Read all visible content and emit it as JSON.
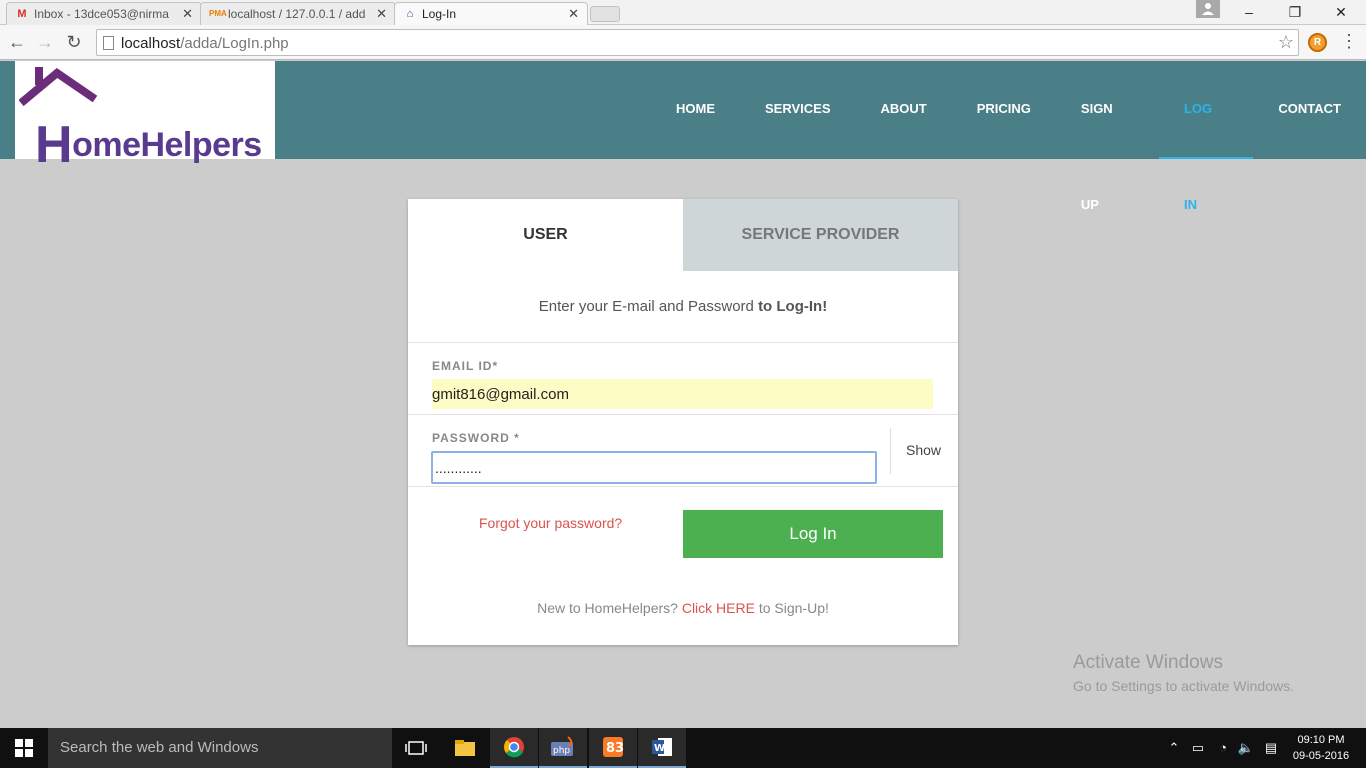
{
  "browser": {
    "tabs": [
      {
        "title": "Inbox - 13dce053@nirma",
        "favicon": "gmail-icon",
        "active": false
      },
      {
        "title": "localhost / 127.0.0.1 / add",
        "favicon": "phpmyadmin-icon",
        "active": false
      },
      {
        "title": "Log-In",
        "favicon": "homehelpers-icon",
        "active": true
      }
    ],
    "url_host": "localhost",
    "url_path": "/adda/LogIn.php",
    "window_controls": {
      "minimize": "–",
      "restore": "❐",
      "close": "✕"
    }
  },
  "site": {
    "logo_text": "omeHelpers",
    "logo_initial": "H",
    "nav": [
      {
        "label": "HOME",
        "active": false
      },
      {
        "label": "SERVICES",
        "active": false
      },
      {
        "label": "ABOUT",
        "active": false
      },
      {
        "label": "PRICING",
        "active": false
      },
      {
        "label": "SIGN UP",
        "active": false
      },
      {
        "label": "LOG IN",
        "active": true
      },
      {
        "label": "CONTACT",
        "active": false
      }
    ],
    "header_color": "#4a7f88",
    "accent_color": "#2bb3ea"
  },
  "login": {
    "tab_user": "USER",
    "tab_provider": "SERVICE PROVIDER",
    "intro_text": "Enter your E-mail and Password ",
    "intro_bold": "to Log-In!",
    "email_label": "EMAIL ID*",
    "email_value": "gmit816@gmail.com",
    "password_label": "PASSWORD *",
    "password_value": "............",
    "show_label": "Show",
    "forgot_label": "Forgot your password?",
    "login_button": "Log In",
    "signup_prefix": "New to HomeHelpers? ",
    "signup_link": "Click HERE",
    "signup_suffix": " to Sign-Up!",
    "button_color": "#4caf50"
  },
  "watermark": {
    "line1": "Activate Windows",
    "line2": "Go to Settings to activate Windows."
  },
  "taskbar": {
    "search_placeholder": "Search the web and Windows",
    "apps": [
      "task-view-icon",
      "file-explorer-icon",
      "chrome-icon",
      "php-icon",
      "xampp-icon",
      "word-icon"
    ],
    "time": "09:10 PM",
    "date": "09-05-2016"
  }
}
